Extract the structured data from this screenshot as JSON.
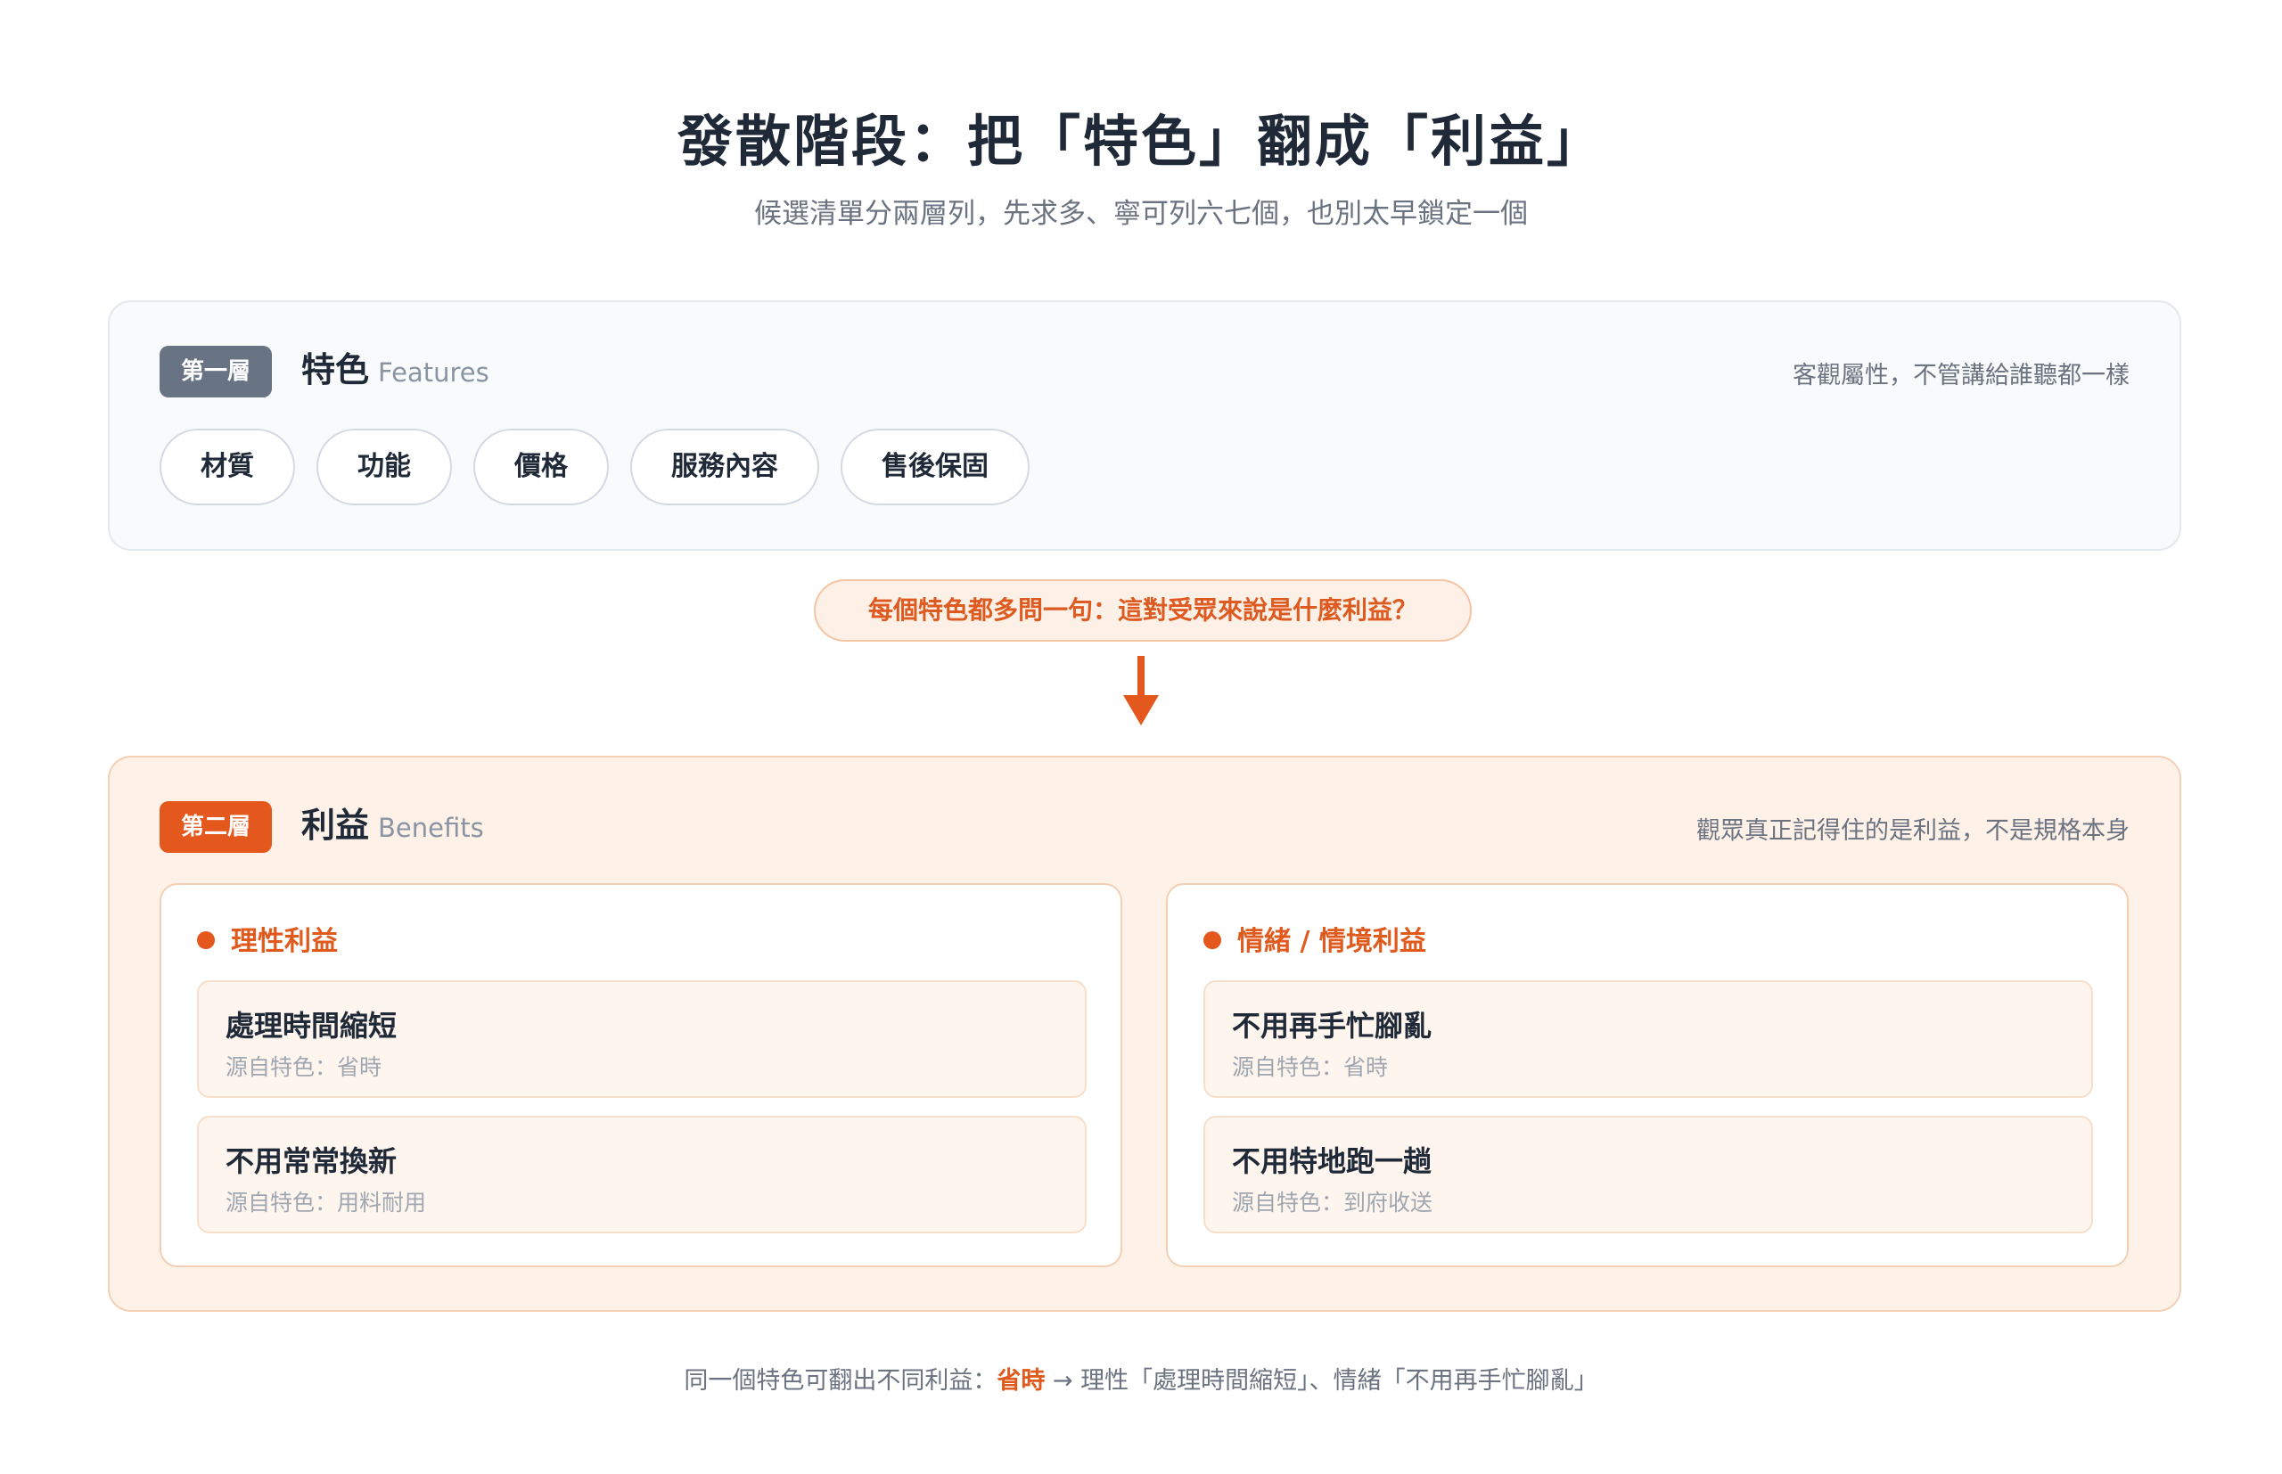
{
  "header": {
    "title": "發散階段：把「特色」翻成「利益」",
    "subtitle": "候選清單分兩層列，先求多、寧可列六七個，也別太早鎖定一個"
  },
  "features_layer": {
    "badge": "第一層",
    "title": "特色",
    "title_en": "Features",
    "note": "客觀屬性，不管講給誰聽都一樣",
    "chips": [
      "材質",
      "功能",
      "價格",
      "服務內容",
      "售後保固"
    ]
  },
  "question": "每個特色都多問一句：這對受眾來說是什麼利益？",
  "benefits_layer": {
    "badge": "第二層",
    "title": "利益",
    "title_en": "Benefits",
    "note": "觀眾真正記得住的是利益，不是規格本身",
    "columns": [
      {
        "heading": "理性利益",
        "items": [
          {
            "title": "處理時間縮短",
            "source": "源自特色：省時"
          },
          {
            "title": "不用常常換新",
            "source": "源自特色：用料耐用"
          }
        ]
      },
      {
        "heading": "情緒 / 情境利益",
        "items": [
          {
            "title": "不用再手忙腳亂",
            "source": "源自特色：省時"
          },
          {
            "title": "不用特地跑一趟",
            "source": "源自特色：到府收送"
          }
        ]
      }
    ]
  },
  "footer": {
    "prefix": "同一個特色可翻出不同利益：",
    "highlight": "省時",
    "suffix": " → 理性「處理時間縮短」、情緒「不用再手忙腳亂」"
  },
  "colors": {
    "accent": "#e5581d",
    "feature_badge": "#687384",
    "benefit_panel_bg": "#fdf1e8"
  }
}
